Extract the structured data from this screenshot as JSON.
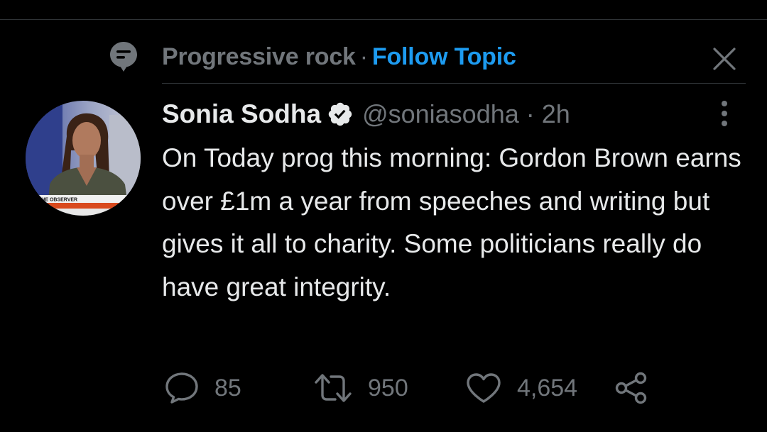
{
  "topic": {
    "name": "Progressive rock",
    "separator": "·",
    "follow_label": "Follow Topic"
  },
  "tweet": {
    "display_name": "Sonia Sodha",
    "handle": "@soniasodha",
    "separator": "·",
    "time": "2h",
    "text": "On Today prog this morning: Gordon Brown earns over £1m a year from speeches and writing but gives it all to charity. Some politicians really do have great integrity.",
    "avatar_caption": "THE OBSERVER",
    "verified": true
  },
  "actions": {
    "replies": "85",
    "retweets": "950",
    "likes": "4,654"
  },
  "icons": {
    "topic": "topic-icon",
    "close": "close-icon",
    "verified": "verified-badge-icon",
    "more": "more-vertical-icon",
    "reply": "reply-icon",
    "retweet": "retweet-icon",
    "like": "heart-icon",
    "share": "share-icon"
  },
  "colors": {
    "background": "#000000",
    "text_primary": "#e7e9ea",
    "text_secondary": "#71767b",
    "accent": "#1d9bf0",
    "divider": "#2f3336"
  }
}
